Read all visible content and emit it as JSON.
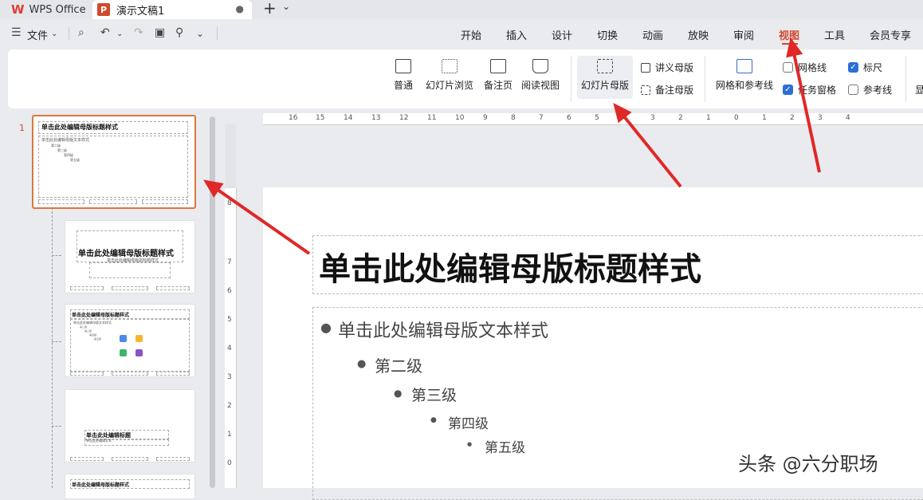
{
  "titlebar": {
    "app_tab": "WPS Office",
    "doc_tab": "演示文稿1",
    "doc_icon": "P",
    "new_tab": "+",
    "tab_menu": "⌄"
  },
  "menubar": {
    "file": "文件",
    "tabs": [
      "开始",
      "插入",
      "设计",
      "切换",
      "动画",
      "放映",
      "审阅",
      "视图",
      "工具",
      "会员专享"
    ],
    "active_tab": "视图",
    "accent_color": "#d4462d"
  },
  "ribbon": {
    "normal": "普通",
    "slide_browse": "幻灯片浏览",
    "notes_page": "备注页",
    "reading_view": "阅读视图",
    "slide_master": "幻灯片母版",
    "handout_master": "讲义母版",
    "notes_master": "备注母版",
    "grid_and_guides": "网格和参考线",
    "gridlines": "网格线",
    "task_pane": "任务窗格",
    "ruler": "标尺",
    "guides": "参考线",
    "more": "显",
    "gridlines_checked": false,
    "ruler_checked": true,
    "task_pane_checked": true,
    "guides_checked": false
  },
  "thumbs": {
    "slide_number": "1",
    "master_title": "单击此处编辑母版标题样式",
    "master_body": "单击此处编辑母版文本样式",
    "level2": "第二级",
    "level3": "第三级",
    "level4": "第四级",
    "level5": "第五级",
    "subtitle": "单击此处编辑母版副标题样式",
    "layout3_title": "单击此处编辑母版标题样式",
    "layout4_title": "单击此处编辑标题",
    "layout4_sub": "单击此处编辑文本",
    "layout5_title": "单击此处编辑母版标题样式"
  },
  "ruler": {
    "h_ticks": [
      "16",
      "15",
      "14",
      "13",
      "12",
      "11",
      "10",
      "9",
      "8",
      "7",
      "6",
      "5",
      "4",
      "3",
      "2",
      "1",
      "0",
      "1",
      "2",
      "3",
      "4"
    ],
    "v_ticks": [
      "8",
      "7",
      "6",
      "5",
      "4",
      "3",
      "2",
      "1",
      "0"
    ]
  },
  "slide": {
    "title": "单击此处编辑母版标题样式",
    "body_l1": "单击此处编辑母版文本样式",
    "body_l2": "第二级",
    "body_l3": "第三级",
    "body_l4": "第四级",
    "body_l5": "第五级"
  },
  "watermark": "头条 @六分职场",
  "arrow_color": "#e02828"
}
